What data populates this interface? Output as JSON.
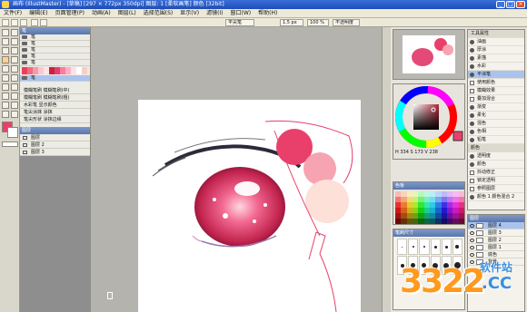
{
  "window": {
    "title": "画布 (IllustMaster) - [草稿] [297 × 772px 350dpi] 图层: 1 [柔软画笔] 颜色 [32bit]"
  },
  "menubar": {
    "items": [
      "文件(F)",
      "编辑(E)",
      "页面管理(P)",
      "动画(A)",
      "图层(L)",
      "选择范围(S)",
      "显示(V)",
      "滤镜(I)",
      "窗口(W)",
      "帮助(H)"
    ]
  },
  "toolbar": {
    "tool_name": "平尖笔",
    "size_value": "1.5 px",
    "zoom_value": "100 %",
    "opacity_label": "不透明度"
  },
  "subtool": {
    "title": "笔",
    "brushes": [
      "笔",
      "笔",
      "笔",
      "笔",
      "笔",
      "笔",
      "笔"
    ],
    "selected_index": 6,
    "tool_props": [
      "模糊笔刷 模糊笔刷(中)",
      "模糊笔刷 模糊笔刷(粗)",
      "水彩笔 显示颜色",
      "笔尖涂抹 涂抹",
      "笔尖形状 涂抹边缘"
    ],
    "layers_title": "图层",
    "layers": [
      "图层",
      "图层 2",
      "图层 3"
    ]
  },
  "colors": {
    "mini_swatches": [
      "#e8405a",
      "#f06a7e",
      "#f49aac",
      "#fbc8d2",
      "#ffe3e8",
      "#c6243c",
      "#e04070",
      "#ff7aa0",
      "#ffb0c4",
      "#fde0ea",
      "#ffffff",
      "#f5d0c8"
    ],
    "current": "#e8406a",
    "hsv_values": [
      "H 334",
      "S 173",
      "V 238"
    ]
  },
  "side_panel": {
    "header": "工具属性",
    "rows": [
      "油画",
      "厚涂",
      "素描",
      "水彩",
      "平涂笔",
      "渐变",
      "柔化",
      "混色",
      "色相",
      "铅笔",
      "透明度",
      "颜色",
      "加深",
      "光泽"
    ],
    "checks": [
      "使用颜色",
      "模糊效果",
      "叠加混合",
      "抖动修正",
      "锁定透明",
      "参照图层"
    ],
    "selected_index": 4,
    "extra": [
      "颜色",
      "纹理",
      "颜色 1 颜色混合 2"
    ]
  },
  "palette": {
    "title": "色板"
  },
  "layers_panel": {
    "title": "图层",
    "rows": [
      "图层 4",
      "图层 3",
      "图层 2",
      "图层 1",
      "底色",
      "背景"
    ],
    "selected_index": 0
  },
  "brush_size": {
    "title": "笔刷尺寸"
  },
  "watermark": {
    "number": "3322",
    "cn_text": "软件站",
    "domain": ".CC"
  },
  "canvas": {
    "circle_colors": [
      "#e8406a",
      "#f6a3b2",
      "#fde0d8"
    ]
  }
}
